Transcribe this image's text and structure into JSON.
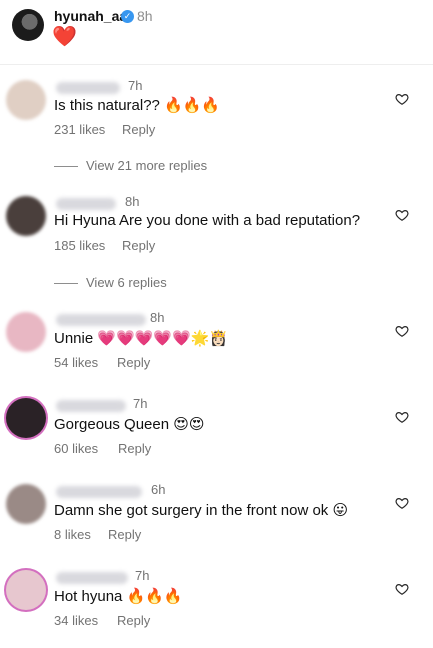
{
  "post": {
    "username": "hyunah_aa",
    "time": "8h",
    "caption": "❤️"
  },
  "comments": [
    {
      "time": "7h",
      "text": "Is this natural?? 🔥🔥🔥",
      "likes": "231 likes",
      "reply": "Reply",
      "view_replies": "View 21 more replies"
    },
    {
      "time": "8h",
      "text": "Hi Hyuna Are you done with a bad reputation?",
      "likes": "185 likes",
      "reply": "Reply",
      "view_replies": "View 6 replies"
    },
    {
      "time": "8h",
      "text": "Unnie 💗💗💗💗💗🌟👸🏻",
      "likes": "54 likes",
      "reply": "Reply"
    },
    {
      "time": "7h",
      "text": "Gorgeous Queen 😍😍",
      "likes": "60 likes",
      "reply": "Reply"
    },
    {
      "time": "6h",
      "text": "Damn she got surgery in the front now ok 😛",
      "likes": "8 likes",
      "reply": "Reply"
    },
    {
      "time": "7h",
      "text": "Hot hyuna 🔥🔥🔥",
      "likes": "34 likes",
      "reply": "Reply"
    }
  ],
  "icons": {
    "like": "heart-outline-icon",
    "verified": "verified-badge-icon"
  },
  "colors": {
    "verified": "#3897f0",
    "secondary_text": "#737373"
  }
}
